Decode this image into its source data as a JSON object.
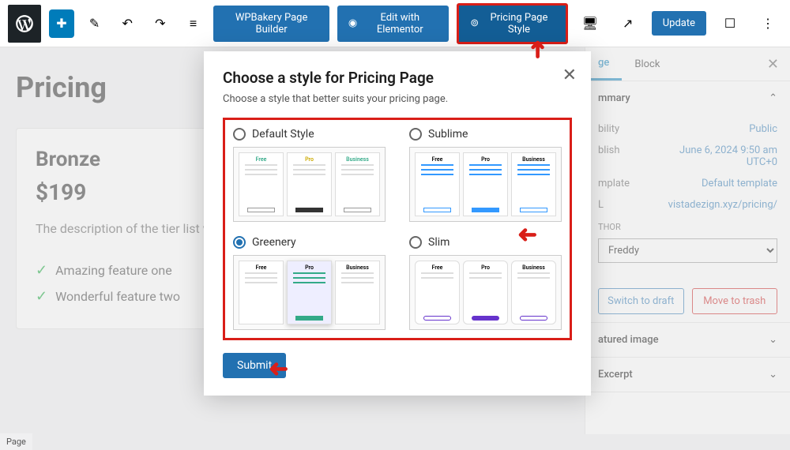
{
  "toolbar": {
    "wpbakery": "WPBakery Page Builder",
    "elementor": "Edit with Elementor",
    "pricing_style": "Pricing Page Style",
    "update": "Update"
  },
  "page": {
    "title": "Pricing",
    "tier_name": "Bronze",
    "tier_price": "$199",
    "tier_desc": "The description of the tier list will go here, it should be concise and",
    "feature1": "Amazing feature one",
    "feature2": "Wonderful feature two",
    "feature2b": "Wonderful feature two"
  },
  "sidebar": {
    "tab_page": "ge",
    "tab_block": "Block",
    "summary_label": "mmary",
    "visibility_label": "bility",
    "visibility_value": "Public",
    "publish_label": "blish",
    "publish_value": "June 6, 2024 9:50 am UTC+0",
    "template_label": "mplate",
    "template_value": "Default template",
    "url_label": "L",
    "url_value": "vistadezign.xyz/pricing/",
    "author_label": "THOR",
    "author_value": "Freddy",
    "draft_btn": "Switch to draft",
    "trash_btn": "Move to trash",
    "featured_label": "atured image",
    "excerpt_label": "Excerpt"
  },
  "modal": {
    "title": "Choose a style for Pricing Page",
    "subtitle": "Choose a style that better suits your pricing page.",
    "style1": "Default Style",
    "style2": "Sublime",
    "style3": "Greenery",
    "style4": "Slim",
    "submit": "Submit"
  },
  "footer": "Page"
}
